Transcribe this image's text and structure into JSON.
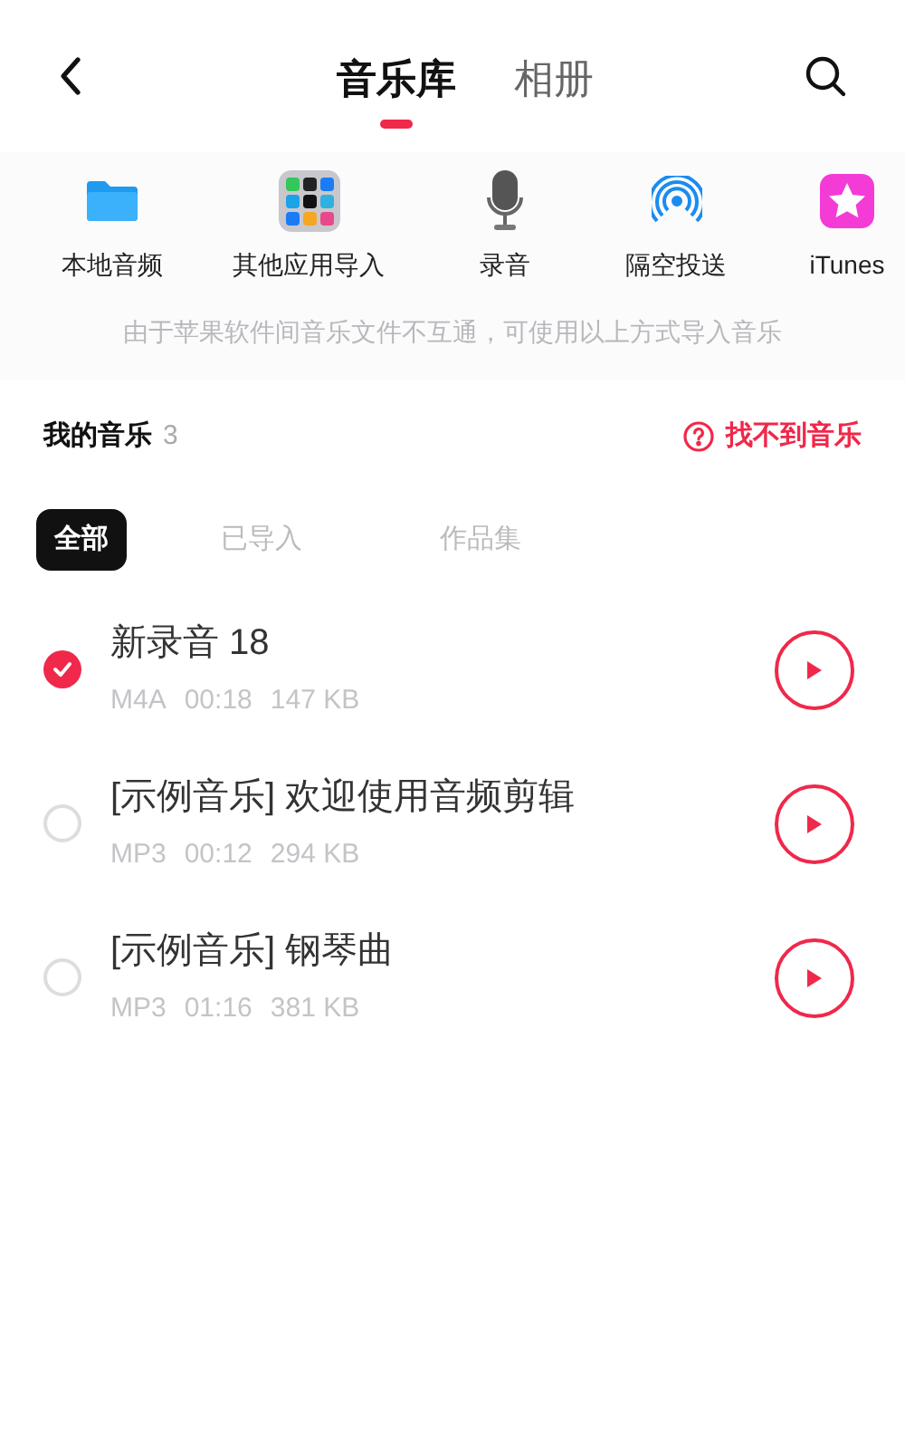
{
  "header": {
    "tabs": [
      {
        "label": "音乐库",
        "selected": true
      },
      {
        "label": "相册",
        "selected": false
      }
    ]
  },
  "sources": [
    {
      "kind": "folder",
      "label": "本地音频"
    },
    {
      "kind": "apps",
      "label": "其他应用导入"
    },
    {
      "kind": "mic",
      "label": "录音"
    },
    {
      "kind": "airdrop",
      "label": "隔空投送"
    },
    {
      "kind": "itunes",
      "label": "iTunes"
    }
  ],
  "hint": "由于苹果软件间音乐文件不互通，可使用以上方式导入音乐",
  "my_music": {
    "title": "我的音乐",
    "count": "3",
    "help": "找不到音乐"
  },
  "filters": [
    {
      "label": "全部",
      "selected": true
    },
    {
      "label": "已导入",
      "selected": false
    },
    {
      "label": "作品集",
      "selected": false
    }
  ],
  "tracks": [
    {
      "title": "新录音 18",
      "meta": [
        "M4A",
        "00:18",
        "147 KB"
      ],
      "checked": true
    },
    {
      "title": "[示例音乐] 欢迎使用音频剪辑",
      "meta": [
        "MP3",
        "00:12",
        "294 KB"
      ],
      "checked": false
    },
    {
      "title": "[示例音乐] 钢琴曲",
      "meta": [
        "MP3",
        "01:16",
        "381 KB"
      ],
      "checked": false
    }
  ]
}
